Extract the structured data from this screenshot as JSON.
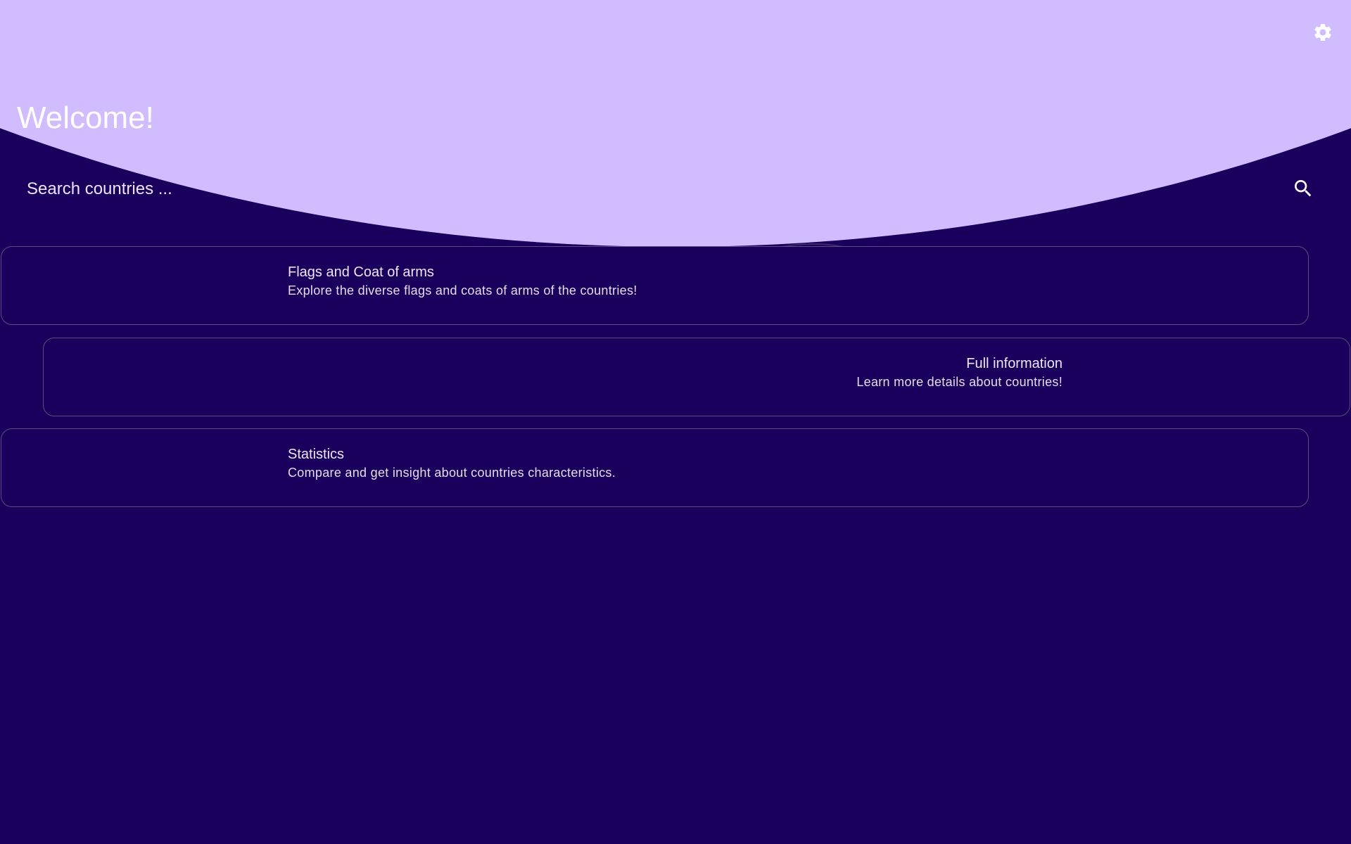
{
  "header": {
    "title": "Welcome!",
    "settings_icon": "gear-icon",
    "background_color": "#d0bcfe"
  },
  "search": {
    "placeholder": "Search countries ...",
    "value": "",
    "icon": "search-icon"
  },
  "menu": {
    "items": [
      {
        "title": "Flags and Coat of arms",
        "description": "Explore the diverse flags and coats of arms of the countries!",
        "align": "left"
      },
      {
        "title": "Full information",
        "description": "Learn more details about countries!",
        "align": "right"
      },
      {
        "title": "Statistics",
        "description": "Compare and get insight about countries characteristics.",
        "align": "left"
      }
    ]
  },
  "colors": {
    "background": "#1a005c",
    "accent": "#d0bcfe",
    "card_border": "#5a4c80",
    "text": "#ece6f6"
  }
}
